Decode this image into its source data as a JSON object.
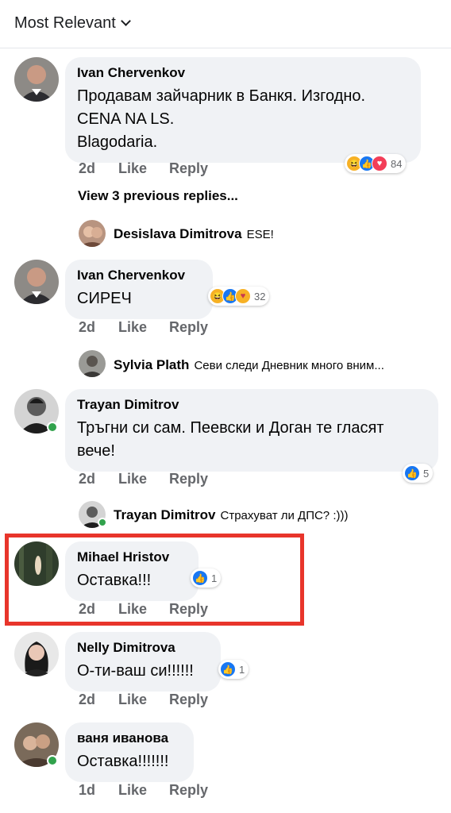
{
  "sort": {
    "label": "Most Relevant"
  },
  "comments": [
    {
      "author": "Ivan Chervenkov",
      "lines": [
        "Продавам зайчарник в Банкя. Изгодно.",
        "CENA NA LS.",
        "Blagodaria."
      ],
      "time": "2d",
      "like": "Like",
      "reply": "Reply",
      "reaction_count": "84",
      "reactions": [
        "haha",
        "like",
        "love"
      ]
    },
    {
      "author": "Ivan Chervenkov",
      "lines": [
        "СИРЕЧ"
      ],
      "time": "2d",
      "like": "Like",
      "reply": "Reply",
      "reaction_count": "32",
      "reactions": [
        "haha",
        "like",
        "care"
      ]
    },
    {
      "author": "Trayan Dimitrov",
      "lines": [
        "Тръгни си сам. Пеевски и Доган те гласят",
        "вече!"
      ],
      "time": "2d",
      "like": "Like",
      "reply": "Reply",
      "reaction_count": "5",
      "reactions": [
        "like"
      ]
    },
    {
      "author": "Mihael Hristov",
      "lines": [
        "Оставка!!!"
      ],
      "time": "2d",
      "like": "Like",
      "reply": "Reply",
      "reaction_count": "1",
      "reactions": [
        "like"
      ]
    },
    {
      "author": "Nelly Dimitrova",
      "lines": [
        "О-ти-ваш си!!!!!!"
      ],
      "time": "2d",
      "like": "Like",
      "reply": "Reply",
      "reaction_count": "1",
      "reactions": [
        "like"
      ]
    },
    {
      "author": "ваня иванова",
      "lines": [
        "Оставка!!!!!!!"
      ],
      "time": "1d",
      "like": "Like",
      "reply": "Reply"
    }
  ],
  "view_previous": "View 3 previous replies...",
  "replies": [
    {
      "author": "Desislava Dimitrova",
      "text": "ESE!"
    },
    {
      "author": "Sylvia Plath",
      "text": "Севи следи Дневник много вним..."
    },
    {
      "author": "Trayan Dimitrov",
      "text": "Страхуват ли ДПС? :)))"
    }
  ],
  "colors": {
    "highlight": "#e8352b",
    "like_blue": "#1877f2",
    "online_green": "#31a24c"
  }
}
